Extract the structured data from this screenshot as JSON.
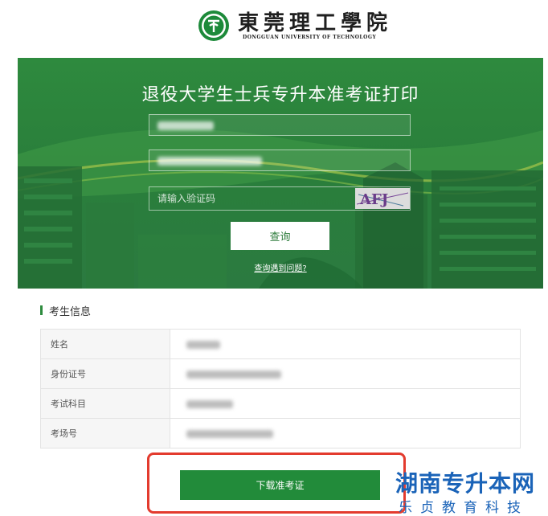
{
  "header": {
    "logo_title": "東莞理工學院",
    "logo_subtitle": "DONGGUAN UNIVERSITY OF TECHNOLOGY"
  },
  "banner": {
    "title": "退役大学生士兵专升本准考证打印",
    "captcha_placeholder": "请输入验证码",
    "captcha_text": "AFJ",
    "query_label": "查询",
    "help_link": "查询遇到问题?"
  },
  "section": {
    "title": "考生信息",
    "rows": [
      {
        "label": "姓名"
      },
      {
        "label": "身份证号"
      },
      {
        "label": "考试科目"
      },
      {
        "label": "考场号"
      }
    ]
  },
  "download": {
    "label": "下载准考证"
  },
  "watermark": {
    "title": "湖南专升本网",
    "subtitle": [
      "乐",
      "贞",
      "教",
      "育",
      "科",
      "技"
    ]
  },
  "colors": {
    "brand_green": "#2e8a3e",
    "button_green": "#228b3a",
    "highlight_red": "#e33b2e",
    "watermark_blue": "#1a63b8"
  }
}
